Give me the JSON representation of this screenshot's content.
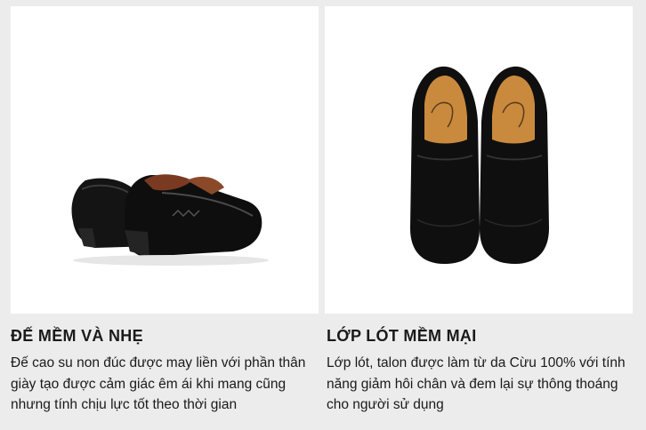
{
  "cards": [
    {
      "image": "black-leather-loafers-rear-view",
      "title": "ĐẾ MỀM VÀ NHẸ",
      "description": "Đế cao su non đúc được may liền với phần thân giày tạo được cảm giác êm ái khi mang cũng nhưng tính chịu lực tốt theo thời gian"
    },
    {
      "image": "black-leather-loafers-top-view",
      "title": "LỚP LÓT MỀM MẠI",
      "description": "Lớp lót, talon được làm từ da Cừu 100% với tính năng giảm hôi chân và đem lại sự thông thoáng cho người sử dụng"
    }
  ]
}
